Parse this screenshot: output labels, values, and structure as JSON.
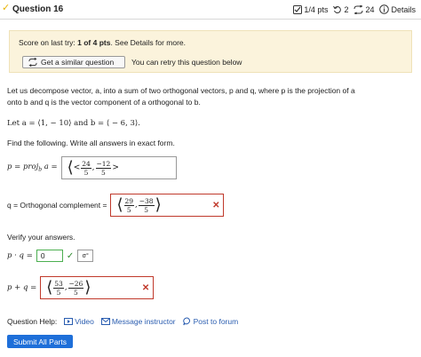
{
  "header": {
    "title": "Question 16",
    "points": "1/4 pts",
    "retries": "2",
    "attempts": "24",
    "details": "Details"
  },
  "score": {
    "prefix": "Score on last try: ",
    "value": "1 of 4 pts",
    "suffix": ". See Details for more.",
    "similar_button": "Get a similar question",
    "retry_text": "You can retry this question below"
  },
  "problem": {
    "line1": "Let us decompose vector, a, into a sum of two orthogonal vectors, p and q, where p is the projection of a",
    "line2": "onto b and q is the vector component of a orthogonal to b.",
    "given": "Let a = ⟨1, − 10⟩ and b = ⟨ − 6, 3⟩.",
    "instructions": "Find the following. Write all answers in exact form."
  },
  "answers": {
    "p_label": "p = proj",
    "p_num1": "24",
    "p_den1": "5",
    "p_num2": "−12",
    "p_den2": "5",
    "q_label": "q = Orthogonal complement =",
    "q_num1": "29",
    "q_den1": "5",
    "q_num2": "−38",
    "q_den2": "5",
    "verify": "Verify your answers.",
    "dot_value": "0",
    "sum_num1": "53",
    "sum_den1": "5",
    "sum_num2": "−26",
    "sum_den2": "5"
  },
  "help": {
    "label": "Question Help:",
    "video": "Video",
    "message": "Message instructor",
    "forum": "Post to forum"
  },
  "submit": "Submit All Parts"
}
